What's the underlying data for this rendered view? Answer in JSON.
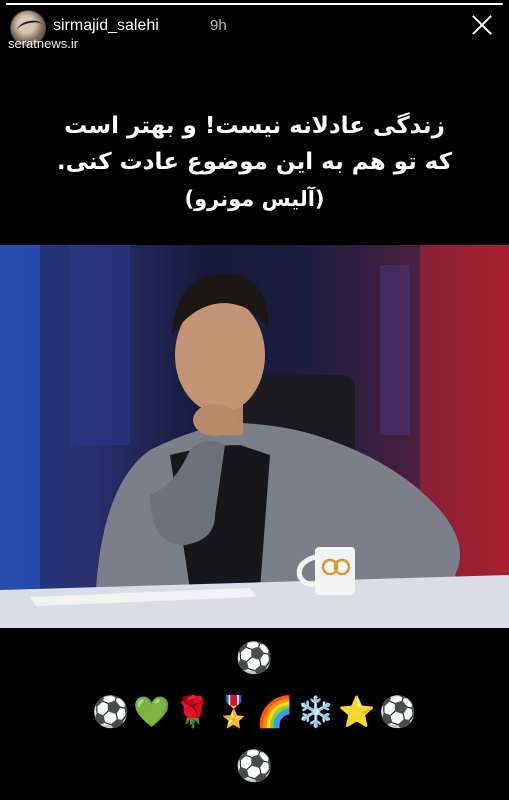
{
  "story": {
    "progress_fraction": 1.0,
    "username": "sirmajid_salehi",
    "time": "9h",
    "watermark": "seratnews.ir"
  },
  "quote": {
    "line1": "زندگی عادلانه نیست! و بهتر است",
    "line2": "که تو هم به این موضوع عادت کنی.",
    "author": "(آلیس مونرو)"
  },
  "photo": {
    "mug_text": "90"
  },
  "emoji_rows": {
    "row1": [
      "⚽"
    ],
    "row2": [
      "⚽",
      "💚",
      "🌹",
      "🎖️",
      "🌈",
      "❄️",
      "⭐",
      "⚽"
    ],
    "row3": [
      "⚽"
    ]
  },
  "icons": {
    "close": "close-icon",
    "avatar": "avatar"
  }
}
